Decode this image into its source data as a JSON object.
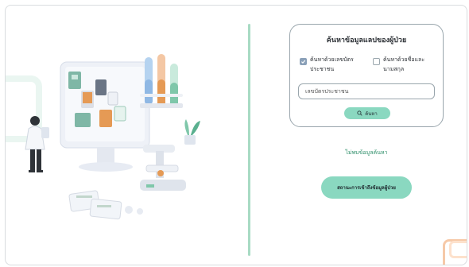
{
  "search_card": {
    "title": "ค้นหาข้อมูลแลปของผู้ป่วย",
    "option_id_card": {
      "label": "ค้นหาด้วยเลขบัตรประชาชน",
      "checked": true
    },
    "option_name": {
      "label": "ค้นหาด้วยชื่อและนามสกุล",
      "checked": false
    },
    "input": {
      "value": "",
      "placeholder": "เลขบัตรประชาชน"
    },
    "search_button": {
      "label": "ค้นหา",
      "icon": "search-icon"
    }
  },
  "result_message": "ไม่พบข้อมูลค้นหา",
  "access_status_button": {
    "label": "สถานะการเข้าถึงข้อมูลผู้ป่วย"
  },
  "illustration": {
    "icon": "lab-illustration"
  },
  "colors": {
    "accent": "#8ad8c0",
    "divider": "#a8dbc4",
    "message": "#2f8f6a",
    "checkbox": "#8aa0b8"
  }
}
